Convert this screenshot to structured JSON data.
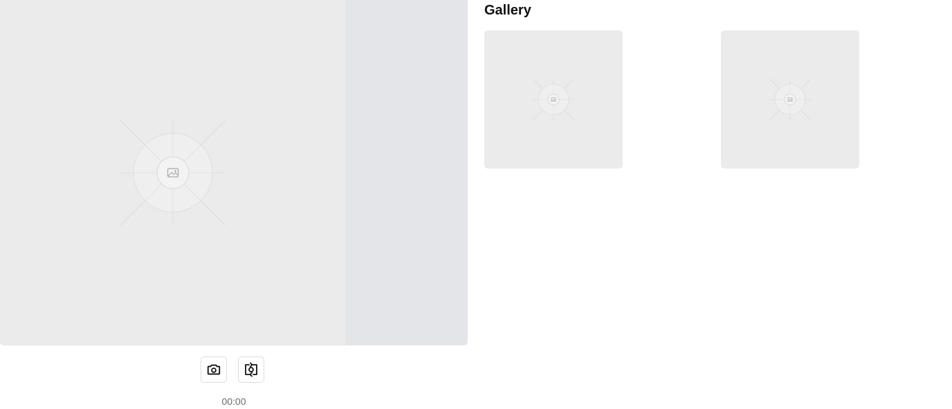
{
  "viewer": {
    "preview_icon": "image-placeholder-icon",
    "side_pane": ""
  },
  "controls": {
    "capture_icon": "camera-icon",
    "switch_icon": "switch-camera-icon",
    "timer": "00:00"
  },
  "gallery": {
    "title": "Gallery",
    "items": [
      {
        "icon": "image-placeholder-icon"
      },
      {
        "icon": "image-placeholder-icon"
      }
    ]
  },
  "colors": {
    "preview_bg": "#ebebeb",
    "side_pane_bg": "#e4e5e8",
    "placeholder_line": "#d9d9d9",
    "timer_text": "#6b6b6b"
  }
}
